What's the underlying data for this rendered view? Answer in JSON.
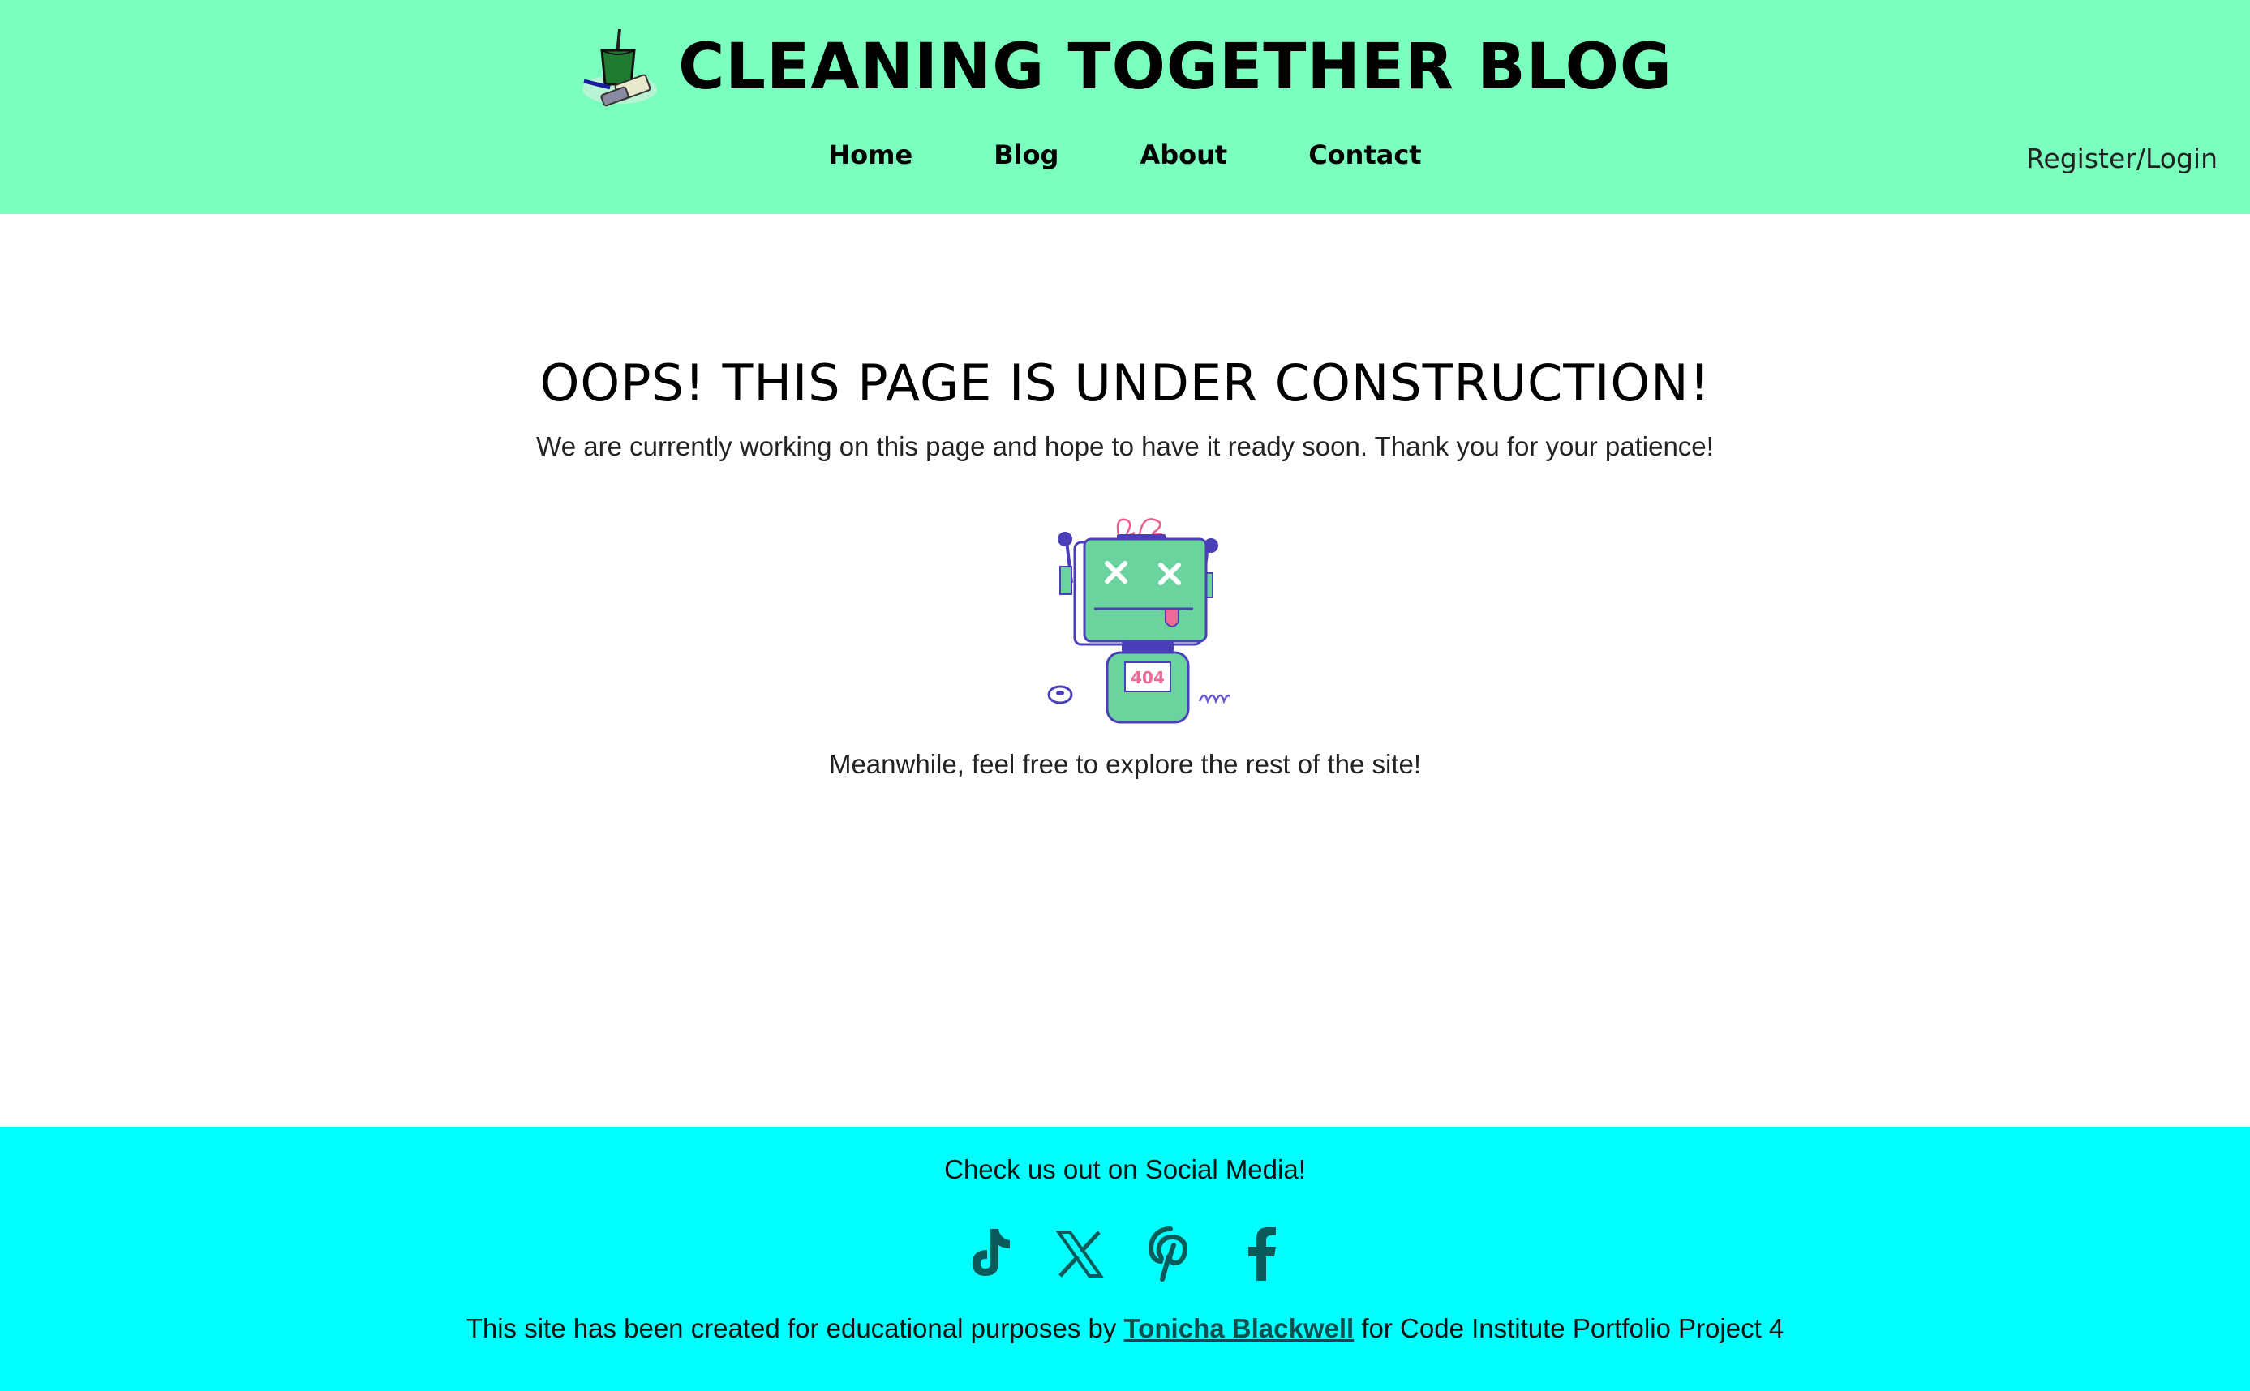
{
  "header": {
    "logo_icon": "cleaning-bucket-icon",
    "title": "CLEANING TOGETHER BLOG",
    "nav": [
      {
        "label": "Home"
      },
      {
        "label": "Blog"
      },
      {
        "label": "About"
      },
      {
        "label": "Contact"
      }
    ],
    "login_label": "Register/Login",
    "background": "#7bffbe"
  },
  "main": {
    "heading": "OOPS! THIS PAGE IS UNDER CONSTRUCTION!",
    "message": "We are currently working on this page and hope to have it ready soon. Thank you for your patience!",
    "illustration": "broken-robot-404-icon",
    "robot_badge": "404",
    "explore_text": "Meanwhile, feel free to explore the rest of the site!"
  },
  "footer": {
    "social_heading": "Check us out on Social Media!",
    "social_icons": [
      "tiktok-icon",
      "x-icon",
      "pinterest-icon",
      "facebook-icon"
    ],
    "credit_prefix": "This site has been created for educational purposes by ",
    "credit_link": "Tonicha Blackwell",
    "credit_suffix": " for Code Institute Portfolio Project 4",
    "background": "#00ffff",
    "icon_color": "#0a5a5a"
  }
}
